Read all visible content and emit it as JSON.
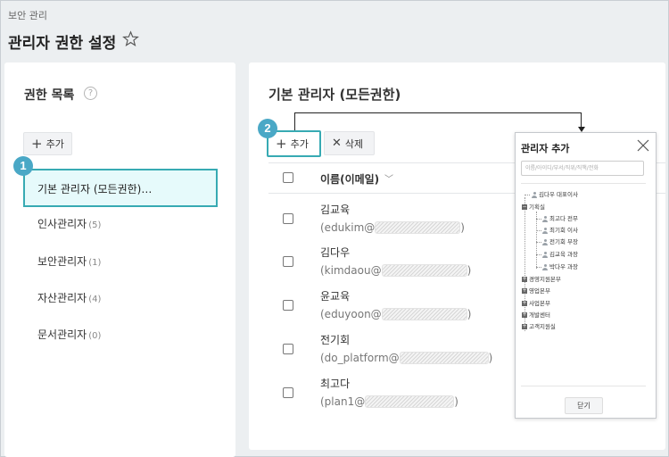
{
  "header": {
    "breadcrumb": "보안 관리",
    "title": "관리자 권한 설정"
  },
  "left_panel": {
    "title": "권한 목록",
    "help_glyph": "?",
    "add_label": "추가",
    "groups": [
      {
        "label": "기본 관리자 (모든권한)…",
        "count": ""
      },
      {
        "label": "인사관리자",
        "count": "(5)"
      },
      {
        "label": "보안관리자",
        "count": "(1)"
      },
      {
        "label": "자산관리자",
        "count": "(4)"
      },
      {
        "label": "문서관리자",
        "count": "(0)"
      }
    ]
  },
  "right_panel": {
    "title": "기본 관리자 (모든권한)",
    "add_label": "추가",
    "delete_label": "삭제",
    "column_name": "이름(이메일)",
    "users": [
      {
        "name": "김교육",
        "email": "(edukim@",
        "email_end": ")"
      },
      {
        "name": "김다우",
        "email": "(kimdaou@",
        "email_end": ")"
      },
      {
        "name": "윤교육",
        "email": "(eduyoon@",
        "email_end": ")"
      },
      {
        "name": "전기회",
        "email": "(do_platform@",
        "email_end": ")"
      },
      {
        "name": "최고다",
        "email": "(plan1@",
        "email_end": ")"
      }
    ]
  },
  "callouts": {
    "one": "1",
    "two": "2"
  },
  "dialog": {
    "title": "관리자 추가",
    "search_placeholder": "이름/아이디/부서/직위/직책/전화",
    "tree": {
      "root": "김다우 대표이사",
      "dept": "기획실",
      "members": [
        "최고다 전무",
        "최기회 이사",
        "전기회 부장",
        "김교육 과장",
        "박다우 과장"
      ],
      "other_depts": [
        "경영지원본부",
        "영업본부",
        "사업본부",
        "개발센터",
        "고객지원실"
      ]
    },
    "close_label": "닫기"
  },
  "colors": {
    "accent": "#37aab3",
    "selected_bg": "#e6fafb",
    "badge": "#4aa8c6",
    "page_bg": "#eceff1"
  }
}
